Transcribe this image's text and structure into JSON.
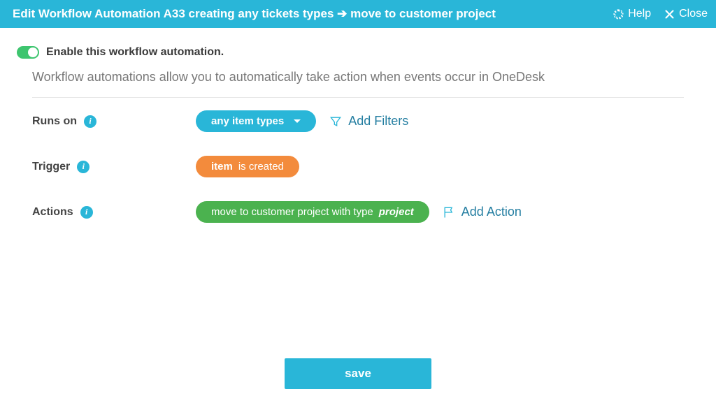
{
  "header": {
    "title": "Edit Workflow Automation A33 creating any tickets types ➔ move to customer project",
    "help": "Help",
    "close": "Close"
  },
  "toggle": {
    "label": "Enable this workflow automation."
  },
  "description": "Workflow automations allow you to automatically take action when events occur in OneDesk",
  "runsOn": {
    "label": "Runs on",
    "pill": "any item types",
    "addFilters": "Add Filters"
  },
  "trigger": {
    "label": "Trigger",
    "bold": "item",
    "rest": "is created"
  },
  "actions": {
    "label": "Actions",
    "pre": "move to customer project with type",
    "italic": "project",
    "addAction": "Add Action"
  },
  "save": "save"
}
